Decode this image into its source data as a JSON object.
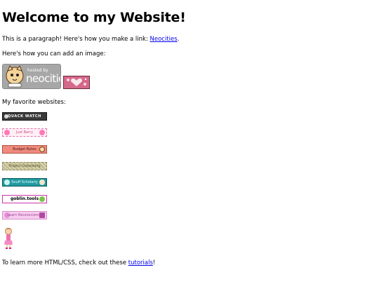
{
  "heading": "Welcome to my Website!",
  "paragraph1": {
    "text_before": "This is a paragraph! Here's how you make a link: ",
    "link_text": "Neocities",
    "text_after": "."
  },
  "paragraph2": "Here's how you can add an image:",
  "hosted_badge": {
    "line1": "hosted by",
    "line2": "neocities"
  },
  "favorites_label": "My favorite websites:",
  "favorite_buttons": [
    {
      "label": "QUACK WATCH"
    },
    {
      "label": "Just Berry"
    },
    {
      "label": "Budget Bytes"
    },
    {
      "label": "Project Gutenberg"
    },
    {
      "label": "Snuff Scholarly"
    },
    {
      "label": "goblin.tools"
    },
    {
      "label": "Learn Neuroscience"
    }
  ],
  "paragraph_last": {
    "text_before": "To learn more HTML/CSS, check out these ",
    "link_text": "tutorials",
    "text_after": "!"
  },
  "colors": {
    "link": "#0000ee",
    "background": "#ffffff",
    "text": "#000000"
  }
}
